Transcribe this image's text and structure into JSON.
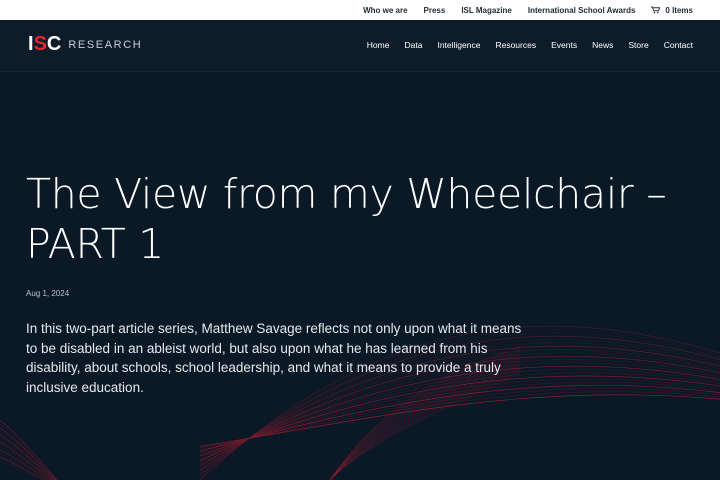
{
  "topbar": {
    "links": [
      "Who we are",
      "Press",
      "ISL Magazine",
      "International School Awards"
    ],
    "cart_label": "0 Items",
    "cart_icon": "cart-icon"
  },
  "logo": {
    "mark_i": "I",
    "mark_s": "S",
    "mark_c": "C",
    "text": "RESEARCH",
    "accent_color": "#e3262f"
  },
  "nav": {
    "items": [
      "Home",
      "Data",
      "Intelligence",
      "Resources",
      "Events",
      "News",
      "Store",
      "Contact"
    ]
  },
  "article": {
    "title": "The View from my Wheelchair – PART 1",
    "date": "Aug 1, 2024",
    "lead": "In this two-part article series, Matthew Savage reflects not only upon what it means to be disabled in an ableist world, but also upon what he has learned from his disability, about schools, school leadership, and what it means to provide a truly inclusive education."
  },
  "colors": {
    "background": "#0b1826",
    "header": "#0e1c2a",
    "topbar": "#ffffff",
    "wave_red": "#c81e35",
    "wave_dark": "#4a1a2a"
  }
}
